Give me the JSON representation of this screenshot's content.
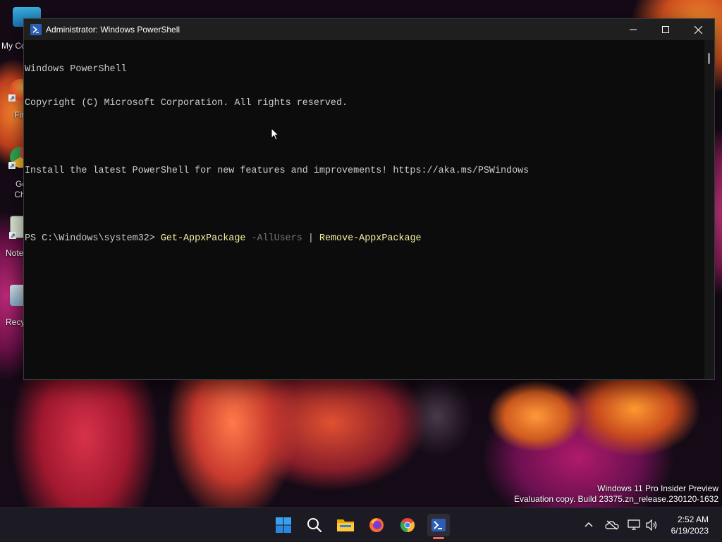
{
  "window": {
    "title": "Administrator: Windows PowerShell",
    "controls": {
      "minimize": "minimize-icon",
      "maximize": "maximize-icon",
      "close": "close-icon"
    }
  },
  "console": {
    "lines": [
      "Windows PowerShell",
      "Copyright (C) Microsoft Corporation. All rights reserved.",
      "",
      "Install the latest PowerShell for new features and improvements! https://aka.ms/PSWindows",
      ""
    ],
    "prompt": "PS C:\\Windows\\system32> ",
    "command": {
      "cmdlet1": "Get-AppxPackage",
      "param": "-AllUsers",
      "pipe": "|",
      "cmdlet2": "Remove-AppxPackage"
    }
  },
  "desktop_icons": [
    {
      "label": "My Co",
      "icon": "monitor-icon"
    },
    {
      "label": "Fir",
      "icon": "firefox-icon"
    },
    {
      "label": "Go Chr",
      "icon": "chrome-icon"
    },
    {
      "label": "Note",
      "icon": "notepad-icon"
    },
    {
      "label": "Recy",
      "icon": "recycle-bin-icon"
    }
  ],
  "watermark": {
    "line1": "Windows 11 Pro Insider Preview",
    "line2": "Evaluation copy. Build 23375.zn_release.230120-1632"
  },
  "taskbar": {
    "icons": [
      "start-icon",
      "search-icon",
      "file-explorer-icon",
      "firefox-icon",
      "chrome-icon",
      "powershell-icon"
    ],
    "active": "powershell-icon"
  },
  "tray": {
    "icons": [
      "chevron-up-icon",
      "onedrive-icon",
      "network-icon",
      "volume-icon"
    ],
    "time": "2:52 AM",
    "date": "6/19/2023"
  },
  "colors": {
    "console_bg": "#0c0c0c",
    "console_text": "#cccccc",
    "cmdlet": "#f9f1a5",
    "param": "#767676",
    "accent": "#f06a5a"
  }
}
